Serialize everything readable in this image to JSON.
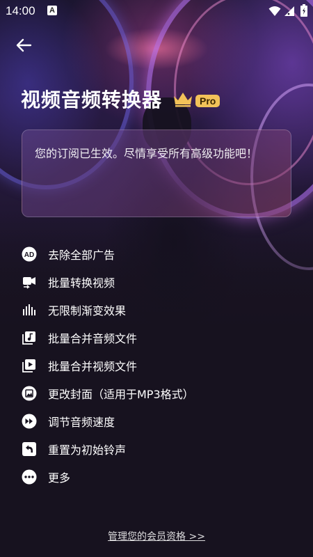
{
  "status_bar": {
    "time": "14:00",
    "app_icon_letter": "A"
  },
  "header": {
    "title": "视频音频转换器",
    "badge": "Pro"
  },
  "message": "您的订阅已生效。尽情享受所有高级功能吧！",
  "features": [
    {
      "label": "去除全部广告",
      "icon": "ad-icon"
    },
    {
      "label": "批量转换视频",
      "icon": "video-convert-icon"
    },
    {
      "label": "无限制渐变效果",
      "icon": "equalizer-icon"
    },
    {
      "label": "批量合并音频文件",
      "icon": "audio-file-icon"
    },
    {
      "label": "批量合并视频文件",
      "icon": "video-file-icon"
    },
    {
      "label": "更改封面（适用于MP3格式）",
      "icon": "image-icon"
    },
    {
      "label": "调节音频速度",
      "icon": "fast-forward-icon"
    },
    {
      "label": "重置为初始铃声",
      "icon": "reset-icon"
    },
    {
      "label": "更多",
      "icon": "more-icon"
    }
  ],
  "footer": {
    "manage_link": "管理您的会员资格 >>"
  },
  "colors": {
    "background": "#17121f",
    "pro_badge": "#f2c259",
    "crown": "#f2c259"
  }
}
